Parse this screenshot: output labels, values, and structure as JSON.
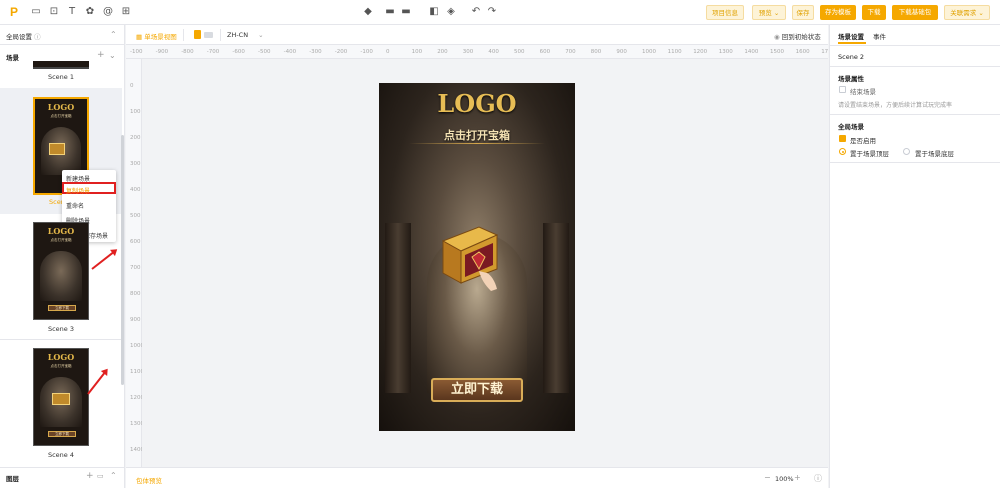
{
  "topbar": {
    "logo_letter": "P",
    "left_icons": [
      "inbox-icon",
      "upload-icon",
      "text-icon",
      "settings-icon",
      "at-icon",
      "layout-icon"
    ],
    "center_icons": [
      "layers-icon",
      "align-icon",
      "align-alt-icon",
      "group-icon",
      "shield-icon",
      "undo-icon",
      "redo-icon"
    ],
    "buttons": {
      "project_info": "项目信息",
      "preview": "预览",
      "save": "保存",
      "save_as_template": "存为模板",
      "download": "下载",
      "download_base": "下载基础包",
      "related_requirements": "关联需求"
    }
  },
  "left_panel": {
    "global_settings": "全局设置",
    "collapse_icon": "chevron-up-icon",
    "scenes_header": "场景",
    "scenes": [
      {
        "label": "Scene 1"
      },
      {
        "label": "Scene 2",
        "thumb_title": "LOGO",
        "thumb_sub": "点击打开宝箱"
      },
      {
        "label": "Scene 3",
        "thumb_title": "LOGO",
        "thumb_sub": "点击打开宝箱",
        "thumb_btn": "立即下载"
      },
      {
        "label": "Scene 4",
        "thumb_title": "LOGO",
        "thumb_sub": "点击打开宝箱",
        "thumb_btn": "立即下载"
      }
    ],
    "scene2_label_partial": "Scen",
    "context_menu": [
      "新建场景",
      "复制场景",
      "重命名",
      "删除场景",
      "新建与保存场景"
    ],
    "layers_header": "图层"
  },
  "editor_toolbar": {
    "single_scene_view": "单场景视图",
    "language": "ZH-CN",
    "reset_state": "回到初始状态"
  },
  "ruler": {
    "top": [
      "-100",
      "-900",
      "-800",
      "-700",
      "-600",
      "-500",
      "-400",
      "-300",
      "-200",
      "-100",
      "0",
      "100",
      "200",
      "300",
      "400",
      "500",
      "600",
      "700",
      "800",
      "900",
      "1000",
      "1100",
      "1200",
      "1300",
      "1400",
      "1500",
      "1600",
      "17"
    ],
    "left": [
      "0",
      "100",
      "200",
      "300",
      "400",
      "500",
      "600",
      "700",
      "800",
      "900",
      "1000",
      "1100",
      "1200",
      "1300",
      "1400"
    ]
  },
  "phone": {
    "logo": "LOGO",
    "title": "点击打开宝箱",
    "download_button": "立即下载"
  },
  "statusbar": {
    "global_settings_link": "包体预览",
    "zoom": "100%",
    "zoom_minus": "−",
    "zoom_plus": "+"
  },
  "right_panel": {
    "tabs": [
      "场景设置",
      "事件"
    ],
    "scene_name": "Scene 2",
    "scene_props_header": "场景属性",
    "end_scene_label": "结束场景",
    "end_scene_hint": "请设置结束场景，方便后续计算试玩完成率",
    "global_scene_header": "全局场景",
    "enable_label": "是否启用",
    "top_layer_label": "置于场景顶层",
    "bottom_layer_label": "置于场景底层"
  },
  "colors": {
    "accent": "#f5a800",
    "annotation_red": "#e02020"
  }
}
